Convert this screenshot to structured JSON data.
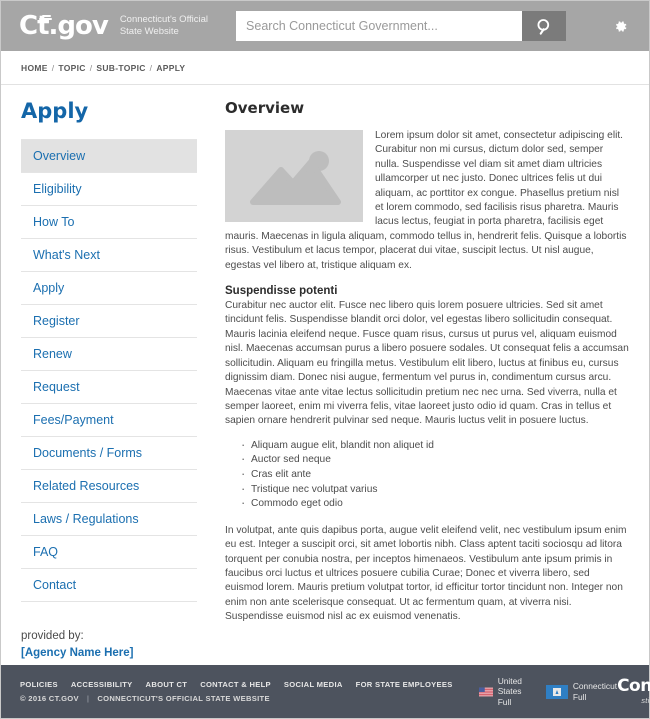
{
  "header": {
    "logo_text": "Ct.gov",
    "logo_icon": "ct-gov-logo-icon",
    "tagline_line1": "Connecticut's Official",
    "tagline_line2": "State Website",
    "search_placeholder": "Search Connecticut Government...",
    "search_value": "",
    "search_icon": "search-icon",
    "settings_icon": "gear-icon"
  },
  "breadcrumb": {
    "items": [
      "HOME",
      "TOPIC",
      "SUB-TOPIC",
      "APPLY"
    ],
    "separator": "/"
  },
  "sidebar": {
    "title": "Apply",
    "items": [
      {
        "label": "Overview",
        "active": true
      },
      {
        "label": "Eligibility",
        "active": false
      },
      {
        "label": "How To",
        "active": false
      },
      {
        "label": "What's Next",
        "active": false
      },
      {
        "label": "Apply",
        "active": false
      },
      {
        "label": "Register",
        "active": false
      },
      {
        "label": "Renew",
        "active": false
      },
      {
        "label": "Request",
        "active": false
      },
      {
        "label": "Fees/Payment",
        "active": false
      },
      {
        "label": "Documents / Forms",
        "active": false
      },
      {
        "label": "Related Resources",
        "active": false
      },
      {
        "label": "Laws / Regulations",
        "active": false
      },
      {
        "label": "FAQ",
        "active": false
      },
      {
        "label": "Contact",
        "active": false
      }
    ],
    "provided_by_label": "provided by:",
    "agency_name": "[Agency Name Here]"
  },
  "main": {
    "heading": "Overview",
    "image_placeholder_icon": "image-placeholder-icon",
    "paragraph1": "Lorem ipsum dolor sit amet, consectetur adipiscing elit. Curabitur non mi cursus, dictum dolor sed, semper nulla. Suspendisse vel diam sit amet diam ultricies ullamcorper ut nec justo. Donec ultrices felis ut dui aliquam, ac porttitor ex congue. Phasellus pretium nisl et lorem commodo, sed facilisis risus pharetra. Mauris lacus lectus, feugiat in porta pharetra, facilisis eget mauris. Maecenas in ligula aliquam, commodo tellus in, hendrerit felis. Quisque a lobortis risus. Vestibulum et lacus tempor, placerat dui vitae, suscipit lectus. Ut nisl augue, egestas vel libero at, tristique aliquam ex.",
    "subheading": "Suspendisse potenti",
    "paragraph2": "Curabitur nec auctor elit. Fusce nec libero quis lorem posuere ultricies. Sed sit amet tincidunt felis. Suspendisse blandit orci dolor, vel egestas libero sollicitudin consequat. Mauris lacinia eleifend neque. Fusce quam risus, cursus ut purus vel, aliquam euismod nisl. Maecenas accumsan purus a libero posuere sodales. Ut consequat felis a accumsan sollicitudin. Aliquam eu fringilla metus. Vestibulum elit libero, luctus at finibus eu, cursus dignissim diam. Donec nisi augue, fermentum vel purus in, condimentum cursus arcu. Maecenas vitae ante vitae lectus sollicitudin pretium nec nec urna. Sed viverra, nulla et semper laoreet, enim mi viverra felis, vitae laoreet justo odio id quam. Cras in tellus et sapien ornare hendrerit pulvinar sed neque. Mauris luctus velit in posuere luctus.",
    "bullets": [
      "Aliquam augue elit, blandit non aliquet id",
      "Auctor sed neque",
      "Cras elit ante",
      "Tristique nec volutpat varius",
      "Commodo eget odio"
    ],
    "paragraph3": "In volutpat, ante quis dapibus porta, augue velit eleifend velit, nec vestibulum ipsum enim eu est. Integer a suscipit orci, sit amet lobortis nibh. Class aptent taciti sociosqu ad litora torquent per conubia nostra, per inceptos himenaeos. Vestibulum ante ipsum primis in faucibus orci luctus et ultrices posuere cubilia Curae; Donec et viverra libero, sed euismod lorem. Mauris pretium volutpat tortor, id efficitur tortor tincidunt non. Integer non enim non ante scelerisque consequat. Ut ac fermentum quam, at viverra nisi. Suspendisse euismod nisl ac ex euismod venenatis."
  },
  "footer": {
    "links": [
      "POLICIES",
      "ACCESSIBILITY",
      "ABOUT CT",
      "CONTACT & HELP",
      "SOCIAL MEDIA",
      "FOR STATE EMPLOYEES"
    ],
    "copyright": "© 2016 CT.GOV",
    "pipe": "|",
    "tagline": "CONNECTICUT'S OFFICIAL STATE WEBSITE",
    "badges": [
      {
        "icon": "us-flag-icon",
        "line1": "United States",
        "line2": "Full"
      },
      {
        "icon": "connecticut-flag-icon",
        "line1": "Connecticut",
        "line2": "Full"
      }
    ],
    "brand_word": "Connecticut",
    "brand_sub": "still revolutionary"
  },
  "colors": {
    "header_bg": "#a6a6a6",
    "footer_bg": "#4d535e",
    "link_blue": "#1b6fb0",
    "title_blue": "#1466a8",
    "active_nav_bg": "#e2e2e2",
    "placeholder_gray": "#d3d3d3"
  }
}
